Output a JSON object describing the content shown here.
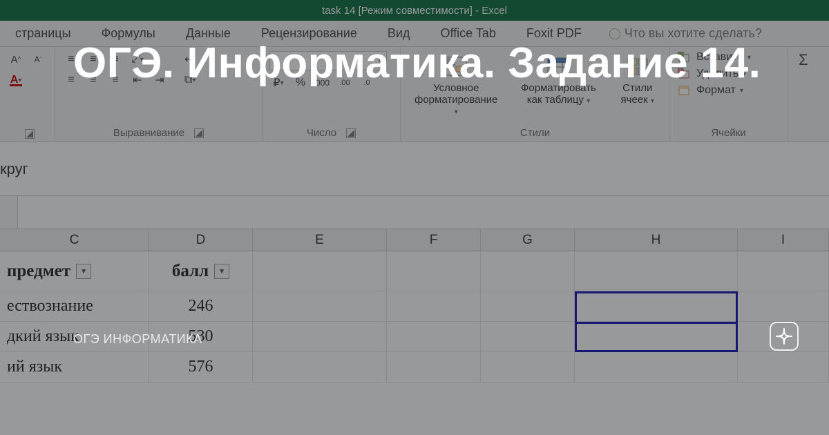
{
  "titlebar": {
    "text": "task 14  [Режим совместимости] - Excel"
  },
  "tabs": {
    "items": [
      "страницы",
      "Формулы",
      "Данные",
      "Рецензирование",
      "Вид",
      "Office Tab",
      "Foxit PDF"
    ],
    "tell_me": "Что вы хотите сделать?"
  },
  "ribbon": {
    "font_group": {
      "label": ""
    },
    "alignment_group": {
      "label": "Выравнивание"
    },
    "number_group": {
      "label": "Число",
      "currency": "₽",
      "percent": "%",
      "thousands": "000",
      "inc_decimal": "‚00→0",
      "dec_decimal": "‚0→00"
    },
    "styles_group": {
      "label": "Стили",
      "cond_fmt": "Условное форматирование",
      "as_table": "Форматировать как таблицу",
      "cell_styles": "Стили ячеек"
    },
    "cells_group": {
      "label": "Ячейки",
      "insert": "Вставить",
      "delete": "Удалить",
      "format": "Формат"
    },
    "editing_group": {
      "sigma": "Σ"
    }
  },
  "formula_bar": {
    "text": "круг"
  },
  "columns": [
    "C",
    "D",
    "E",
    "F",
    "G",
    "H",
    "I"
  ],
  "sheet": {
    "headers": {
      "c": "предмет",
      "d": "балл"
    },
    "rows": [
      {
        "c": "ествознание",
        "d": "246"
      },
      {
        "c": "дкий язык",
        "d": "530"
      },
      {
        "c": "ий язык",
        "d": "576"
      }
    ]
  },
  "overlay": {
    "title": "ОГЭ. Информатика. Задание 14.",
    "author": "ОГЭ ИНФОРМАТИКА"
  }
}
